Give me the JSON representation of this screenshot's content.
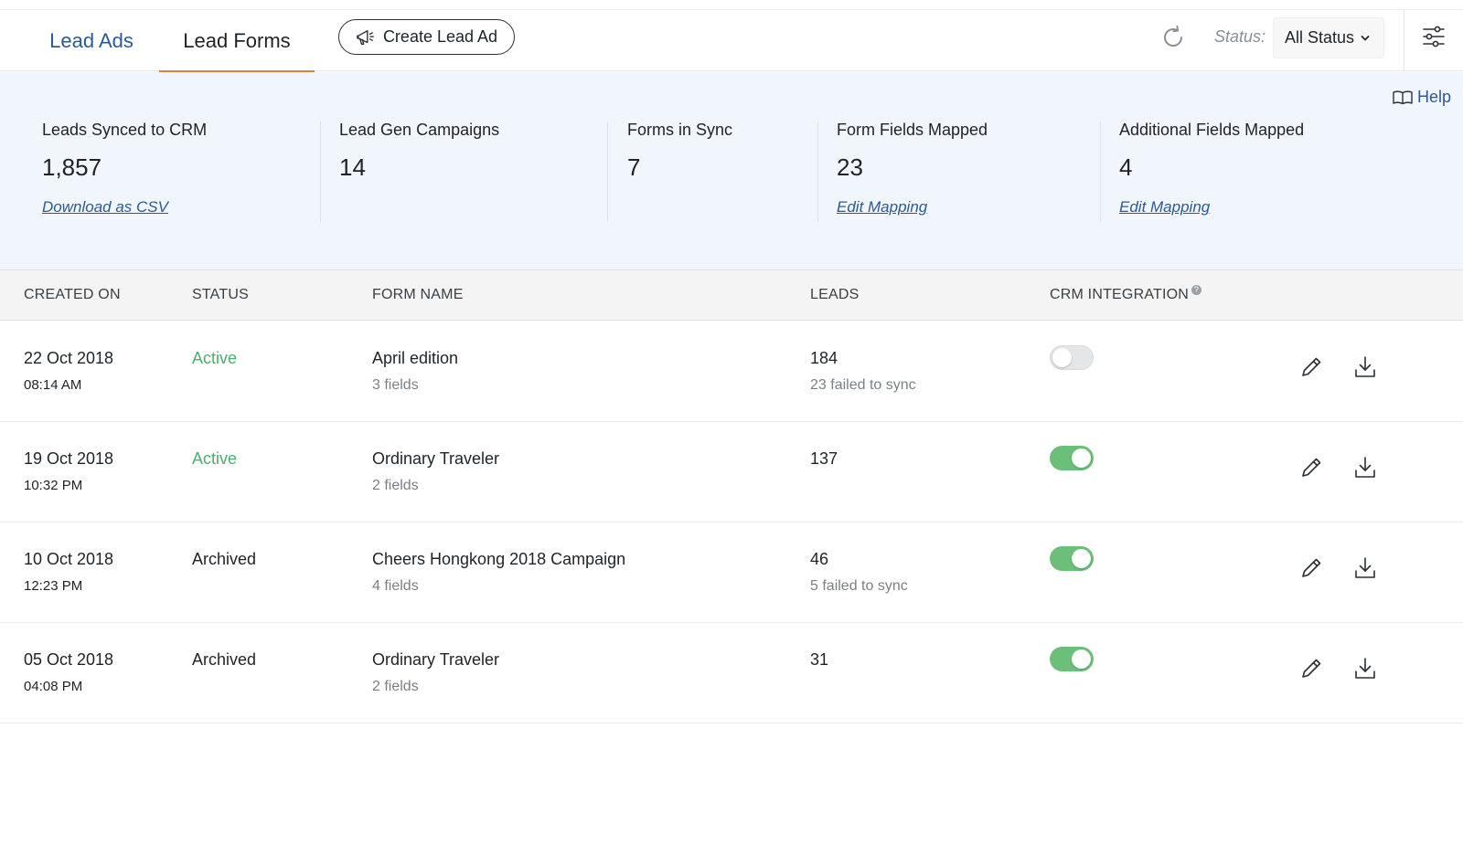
{
  "tabs": [
    {
      "label": "Lead Ads",
      "active": false
    },
    {
      "label": "Lead Forms",
      "active": true
    }
  ],
  "create_button": {
    "label": "Create Lead Ad",
    "icon": "megaphone-icon"
  },
  "status_filter": {
    "label": "Status:",
    "selected": "All Status"
  },
  "help": {
    "label": "Help"
  },
  "stats": [
    {
      "label": "Leads Synced to CRM",
      "value": "1,857",
      "link": "Download as CSV"
    },
    {
      "label": "Lead Gen Campaigns",
      "value": "14",
      "link": ""
    },
    {
      "label": "Forms in Sync",
      "value": "7",
      "link": ""
    },
    {
      "label": "Form Fields Mapped",
      "value": "23",
      "link": "Edit Mapping"
    },
    {
      "label": "Additional Fields Mapped",
      "value": "4",
      "link": "Edit Mapping"
    }
  ],
  "table": {
    "headers": [
      "CREATED ON",
      "STATUS",
      "FORM NAME",
      "LEADS",
      "CRM INTEGRATION"
    ],
    "rows": [
      {
        "date": "22 Oct 2018",
        "time": "08:14 AM",
        "status": "Active",
        "form": "April edition",
        "fields": "3 fields",
        "leads": "184",
        "sync_note": "23 failed to sync",
        "crm_on": false
      },
      {
        "date": "19 Oct 2018",
        "time": "10:32 PM",
        "status": "Active",
        "form": "Ordinary Traveler",
        "fields": "2 fields",
        "leads": "137",
        "sync_note": "",
        "crm_on": true
      },
      {
        "date": "10 Oct 2018",
        "time": "12:23 PM",
        "status": "Archived",
        "form": "Cheers Hongkong 2018 Campaign",
        "fields": "4 fields",
        "leads": "46",
        "sync_note": "5 failed to sync",
        "crm_on": true
      },
      {
        "date": "05 Oct 2018",
        "time": "04:08 PM",
        "status": "Archived",
        "form": "Ordinary Traveler",
        "fields": "2 fields",
        "leads": "31",
        "sync_note": "",
        "crm_on": true
      }
    ]
  },
  "colors": {
    "accent_blue": "#2c5a94",
    "tab_underline": "#e6802c",
    "active_status": "#4caf6e",
    "archived_status": "#1f2328",
    "toggle_on": "#6cbf78",
    "summary_bg": "#f1f6fd"
  }
}
